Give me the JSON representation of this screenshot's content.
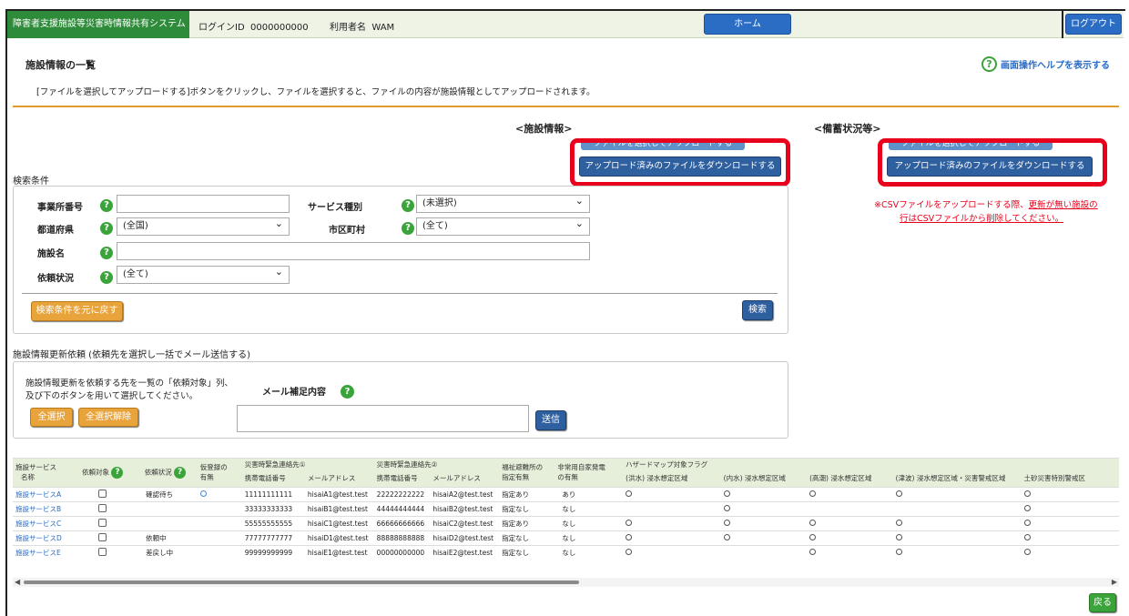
{
  "header": {
    "system_title": "障害者支援施設等災害時情報共有システム",
    "login_id_label": "ログインID",
    "login_id": "0000000000",
    "user_label": "利用者名",
    "user_name": "WAM",
    "home": "ホーム",
    "logout": "ログアウト"
  },
  "page": {
    "title": "施設情報の一覧",
    "help": "画面操作ヘルプを表示する",
    "instruction": "[ファイルを選択してアップロードする]ボタンをクリックし、ファイルを選択すると、ファイルの内容が施設情報としてアップロードされます。"
  },
  "facility_info": {
    "title": "<施設情報>",
    "upload": "ファイルを選択してアップロードする",
    "download": "アップロード済みのファイルをダウンロードする"
  },
  "stockpile": {
    "title": "<備蓄状況等>",
    "upload": "ファイルを選択してアップロードする",
    "download": "アップロード済みのファイルをダウンロードする",
    "note_prefix": "※CSVファイルをアップロードする際、",
    "note_underlined_1": "更新が無い施設の",
    "note_underlined_2": "行はCSVファイルから削除してください。"
  },
  "search": {
    "section_label": "検索条件",
    "office_number_label": "事業所番号",
    "service_type_label": "サービス種別",
    "service_type_value": "(未選択)",
    "prefecture_label": "都道府県",
    "prefecture_value": "(全国)",
    "city_label": "市区町村",
    "city_value": "(全て)",
    "facility_name_label": "施設名",
    "request_status_label": "依頼状況",
    "request_status_value": "(全て)",
    "reset": "検索条件を元に戻す",
    "search": "検索",
    "help_mark": "?"
  },
  "update_request": {
    "section_label": "施設情報更新依頼 (依頼先を選択し一括でメール送信する)",
    "text_1": "施設情報更新を依頼する先を一覧の「依頼対象」列、",
    "text_2": "及び下のボタンを用いて選択してください。",
    "select_all": "全選択",
    "deselect_all": "全選択解除",
    "mail_label": "メール補足内容",
    "send": "送信"
  },
  "table": {
    "group_headers": {
      "contact1": "災害時緊急連絡先①",
      "contact2": "災害時緊急連絡先②",
      "hazard": "ハザードマップ対象フラグ"
    },
    "headers": {
      "service_name_1": "施設サービス",
      "service_name_2": "名称",
      "request_target": "依頼対象",
      "request_status": "依頼状況",
      "provisional_1": "仮登録の",
      "provisional_2": "有無",
      "phone": "携帯電話番号",
      "email": "メールアドレス",
      "welfare_1": "福祉避難所の",
      "welfare_2": "指定有無",
      "generator_1": "非常用自家発電",
      "generator_2": "の有無",
      "flood": "(洪水) 浸水想定区域",
      "inland": "(内水) 浸水想定区域",
      "storm": "(高潮) 浸水想定区域",
      "tsunami": "(津波) 浸水想定区域・災害警戒区域",
      "landslide": "土砂災害特別警戒区"
    },
    "rows": [
      {
        "name": "施設サービスA",
        "status": "確認待ち",
        "provisional": "○",
        "phone1": "11111111111",
        "email1": "hisaiA1@test.test",
        "phone2": "22222222222",
        "email2": "hisaiA2@test.test",
        "welfare": "指定あり",
        "generator": "あり",
        "flood": "○",
        "inland": "○",
        "storm": "○",
        "tsunami": "○",
        "landslide": "○"
      },
      {
        "name": "施設サービスB",
        "status": "",
        "provisional": "",
        "phone1": "33333333333",
        "email1": "hisaiB1@test.test",
        "phone2": "44444444444",
        "email2": "hisaiB2@test.test",
        "welfare": "指定なし",
        "generator": "なし",
        "flood": "",
        "inland": "○",
        "storm": "",
        "tsunami": "",
        "landslide": "○"
      },
      {
        "name": "施設サービスC",
        "status": "",
        "provisional": "",
        "phone1": "55555555555",
        "email1": "hisaiC1@test.test",
        "phone2": "66666666666",
        "email2": "hisaiC2@test.test",
        "welfare": "指定あり",
        "generator": "なし",
        "flood": "○",
        "inland": "○",
        "storm": "○",
        "tsunami": "○",
        "landslide": "○"
      },
      {
        "name": "施設サービスD",
        "status": "依頼中",
        "provisional": "",
        "phone1": "77777777777",
        "email1": "hisaiD1@test.test",
        "phone2": "88888888888",
        "email2": "hisaiD2@test.test",
        "welfare": "指定なし",
        "generator": "なし",
        "flood": "○",
        "inland": "○",
        "storm": "○",
        "tsunami": "○",
        "landslide": "○"
      },
      {
        "name": "施設サービスE",
        "status": "差戻し中",
        "provisional": "",
        "phone1": "99999999999",
        "email1": "hisaiE1@test.test",
        "phone2": "00000000000",
        "email2": "hisaiE2@test.test",
        "welfare": "指定なし",
        "generator": "なし",
        "flood": "○",
        "inland": "",
        "storm": "○",
        "tsunami": "○",
        "landslide": "○"
      }
    ]
  },
  "footer": {
    "back": "戻る"
  }
}
